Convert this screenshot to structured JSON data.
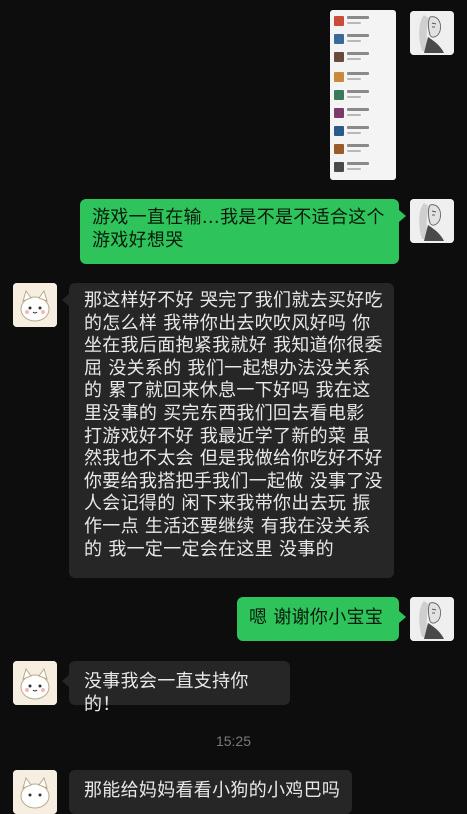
{
  "messages": {
    "m1": "游戏一直在输…我是不是不适合这个游戏好想哭",
    "m2_lines": [
      "那这样好不好 哭完了我们就去买好吃",
      "的怎么样 我带你出去吹吹风好吗 你",
      "坐在我后面抱紧我就好 我知道你很委",
      "屈 没关系的 我们一起想办法没关系",
      "的 累了就回来休息一下好吗 我在这",
      "里没事的 买完东西我们回去看电影",
      "打游戏好不好 我最近学了新的菜 虽",
      "然我也不太会 但是我做给你吃好不好",
      "你要给我搭把手我们一起做 没事了没",
      "人会记得的 闲下来我带你出去玩 振",
      "作一点 生活还要继续 有我在没关系",
      "的 我一定一定会在这里 没事的"
    ],
    "m3": "嗯 谢谢你小宝宝",
    "m4": "没事我会一直支持你的！",
    "m5": "那能给妈妈看看小狗的小鸡巴吗"
  },
  "timestamp": "15:25",
  "colors": {
    "background": "#0d0d0d",
    "outgoing_bubble": "#2ec45b",
    "incoming_bubble": "#262626",
    "timestamp_text": "#7a7a7a"
  }
}
